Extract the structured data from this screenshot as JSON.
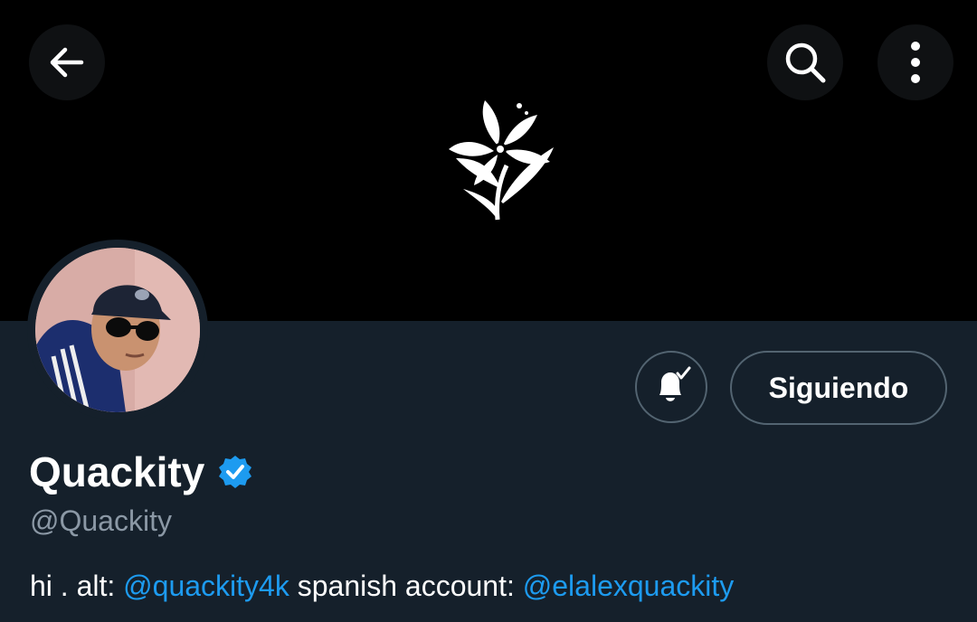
{
  "header": {
    "icons": {
      "back": "arrow-left-icon",
      "search": "search-icon",
      "more": "more-vertical-icon"
    },
    "banner_logo": "flower-logo"
  },
  "profile": {
    "display_name": "Quackity",
    "handle": "@Quackity",
    "verified": true,
    "follow_button_label": "Siguiendo",
    "notifications_icon": "bell-check-icon",
    "bio": {
      "prefix": "hi . alt: ",
      "mention_1": "@quackity4k",
      "middle": " spanish account: ",
      "mention_2": "@elalexquackity"
    }
  },
  "colors": {
    "background": "#15202b",
    "banner": "#000000",
    "accent": "#1d9bf0",
    "secondary_text": "#8b98a5",
    "border": "#536471"
  }
}
